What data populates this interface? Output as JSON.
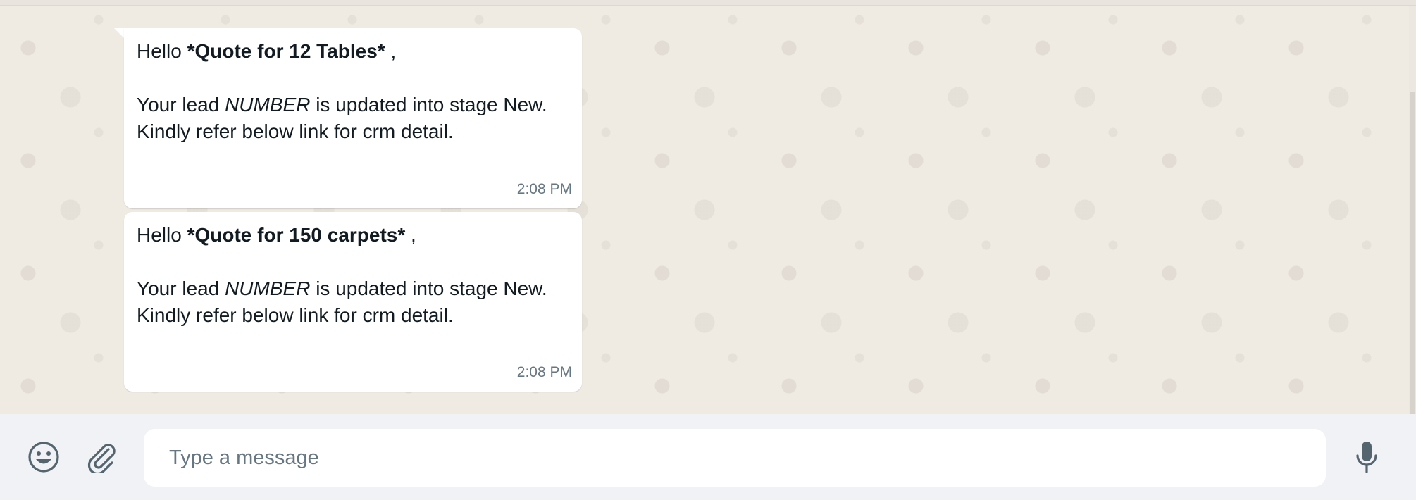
{
  "messages": [
    {
      "greeting": "Hello ",
      "quote": "*Quote for 12 Tables*",
      "after_quote": " ,",
      "lead_prefix": "Your lead ",
      "lead_token": "NUMBER",
      "lead_suffix": " is updated into stage New.",
      "refer": "Kindly refer below link for crm detail.",
      "time": "2:08 PM"
    },
    {
      "greeting": "Hello ",
      "quote": "*Quote for 150 carpets*",
      "after_quote": " ,",
      "lead_prefix": "Your lead ",
      "lead_token": "NUMBER",
      "lead_suffix": " is updated into stage New.",
      "refer": "Kindly refer below link for crm detail.",
      "time": "2:08 PM"
    }
  ],
  "composer": {
    "placeholder": "Type a message",
    "emoji_icon": "emoji-icon",
    "attach_icon": "paperclip-icon",
    "mic_icon": "microphone-icon"
  },
  "colors": {
    "chat_background": "#efeae2",
    "bubble": "#ffffff",
    "footer": "#f0f2f5",
    "timestamp": "#667781",
    "icon": "#54656f"
  }
}
